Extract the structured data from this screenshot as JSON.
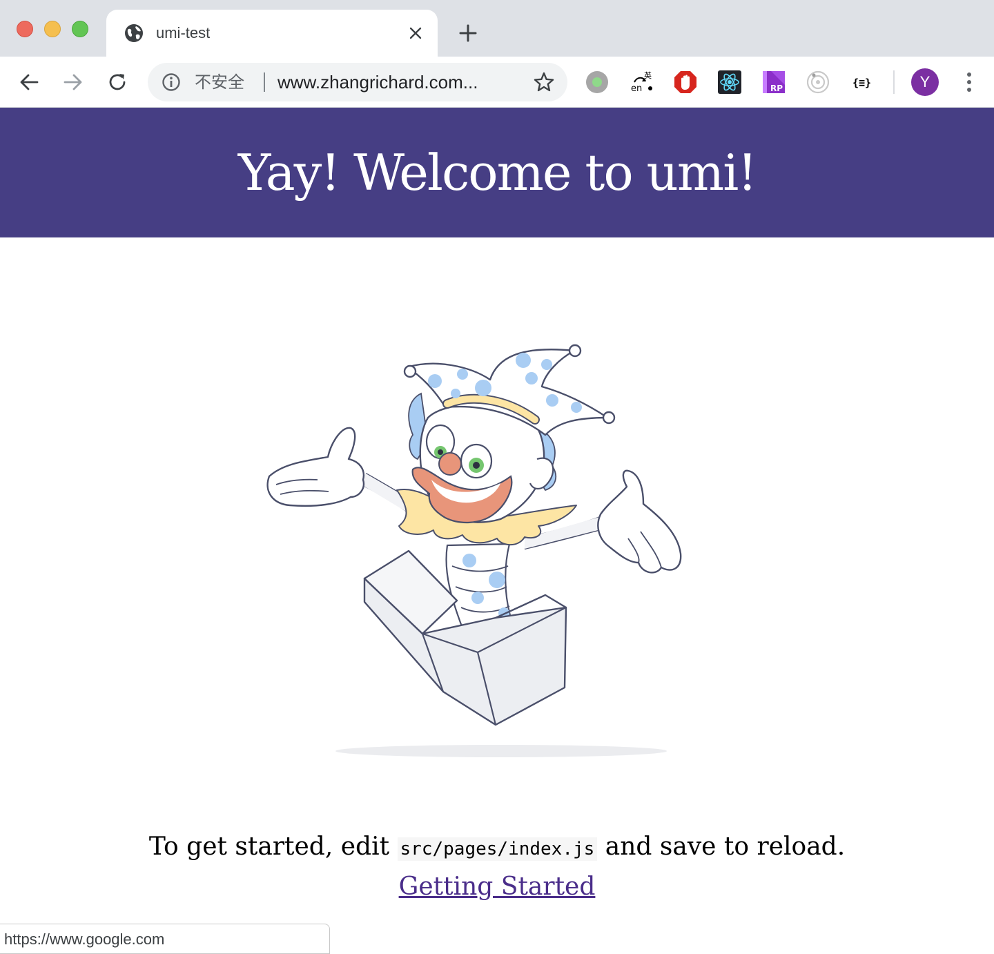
{
  "browser": {
    "tab": {
      "title": "umi-test",
      "favicon": "globe-icon"
    },
    "address_bar": {
      "security_label": "不安全",
      "url": "www.zhangrichard.com..."
    },
    "profile_initial": "Y",
    "status_url": "https://www.google.com"
  },
  "page": {
    "banner_title": "Yay! Welcome to umi!",
    "intro_before": "To get started, edit",
    "intro_code": "src/pages/index.js",
    "intro_after": "and save to reload.",
    "link_label": "Getting Started"
  },
  "colors": {
    "banner_bg": "#463e84",
    "link": "#4a2d8a",
    "avatar": "#7b2fa2"
  },
  "icons": [
    "globe-icon",
    "close-icon",
    "plus-icon",
    "back-arrow-icon",
    "forward-arrow-icon",
    "reload-icon",
    "info-icon",
    "star-icon",
    "extension-record-icon",
    "translate-icon",
    "adblock-icon",
    "react-devtools-icon",
    "axure-rp-icon",
    "extension-target-icon",
    "json-formatter-icon",
    "menu-dots-icon"
  ]
}
